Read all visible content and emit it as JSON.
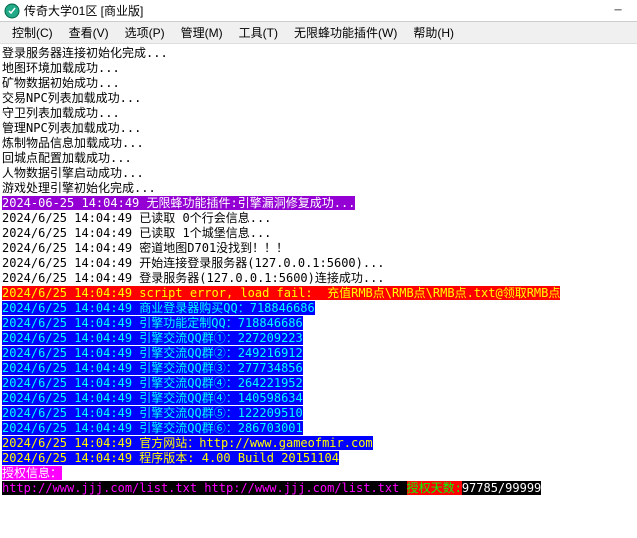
{
  "titlebar": {
    "text": "传奇大学01区 [商业版]"
  },
  "menu": {
    "control": "控制(C)",
    "view": "查看(V)",
    "options": "选项(P)",
    "manage": "管理(M)",
    "tools": "工具(T)",
    "plugin": "无限蜂功能插件(W)",
    "help": "帮助(H)"
  },
  "log": {
    "init_lines": [
      "登录服务器连接初始化完成...",
      "地图环境加载成功...",
      "矿物数据初始成功...",
      "交易NPC列表加载成功...",
      "守卫列表加载成功...",
      "管理NPC列表加载成功...",
      "炼制物品信息加载成功...",
      "回城点配置加载成功...",
      "人物数据引擎启动成功...",
      "游戏处理引擎初始化完成..."
    ],
    "purple_line": "2024-06-25 14:04:49 无限蜂功能插件:引擎漏洞修复成功...",
    "plain_ts_lines": [
      "2024/6/25 14:04:49 已读取 0个行会信息...",
      "2024/6/25 14:04:49 已读取 1个城堡信息...",
      "2024/6/25 14:04:49 密道地图D701没找到！！！",
      "2024/6/25 14:04:49 开始连接登录服务器(127.0.0.1:5600)...",
      "2024/6/25 14:04:49 登录服务器(127.0.0.1:5600)连接成功..."
    ],
    "red_line": "2024/6/25 14:04:49 script error, load fail:  充值RMB点\\RMB点\\RMB点.txt@领取RMB点",
    "blue_lines": [
      "2024/6/25 14:04:49 商业登录器购买QQ：718846686",
      "2024/6/25 14:04:49 引擎功能定制QQ：718846686",
      "2024/6/25 14:04:49 引擎交流QQ群①：227209223",
      "2024/6/25 14:04:49 引擎交流QQ群②：249216912",
      "2024/6/25 14:04:49 引擎交流QQ群③：277734856",
      "2024/6/25 14:04:49 引擎交流QQ群④：264221952",
      "2024/6/25 14:04:49 引擎交流QQ群④：140598634",
      "2024/6/25 14:04:49 引擎交流QQ群⑤：122209510",
      "2024/6/25 14:04:49 引擎交流QQ群⑥：286703001"
    ],
    "blue_yellow_lines": [
      "2024/6/25 14:04:49 官方网站：http://www.gameofmir.com",
      "2024/6/25 14:04:49 程序版本: 4.00 Build 20151104"
    ],
    "auth_label": "授权信息：",
    "bottom": {
      "urls": "http://www.jjj.com/list.txt http://www.jjj.com/list.txt ",
      "days_label": "授权天数:",
      "days_value": "97785/99999"
    }
  }
}
